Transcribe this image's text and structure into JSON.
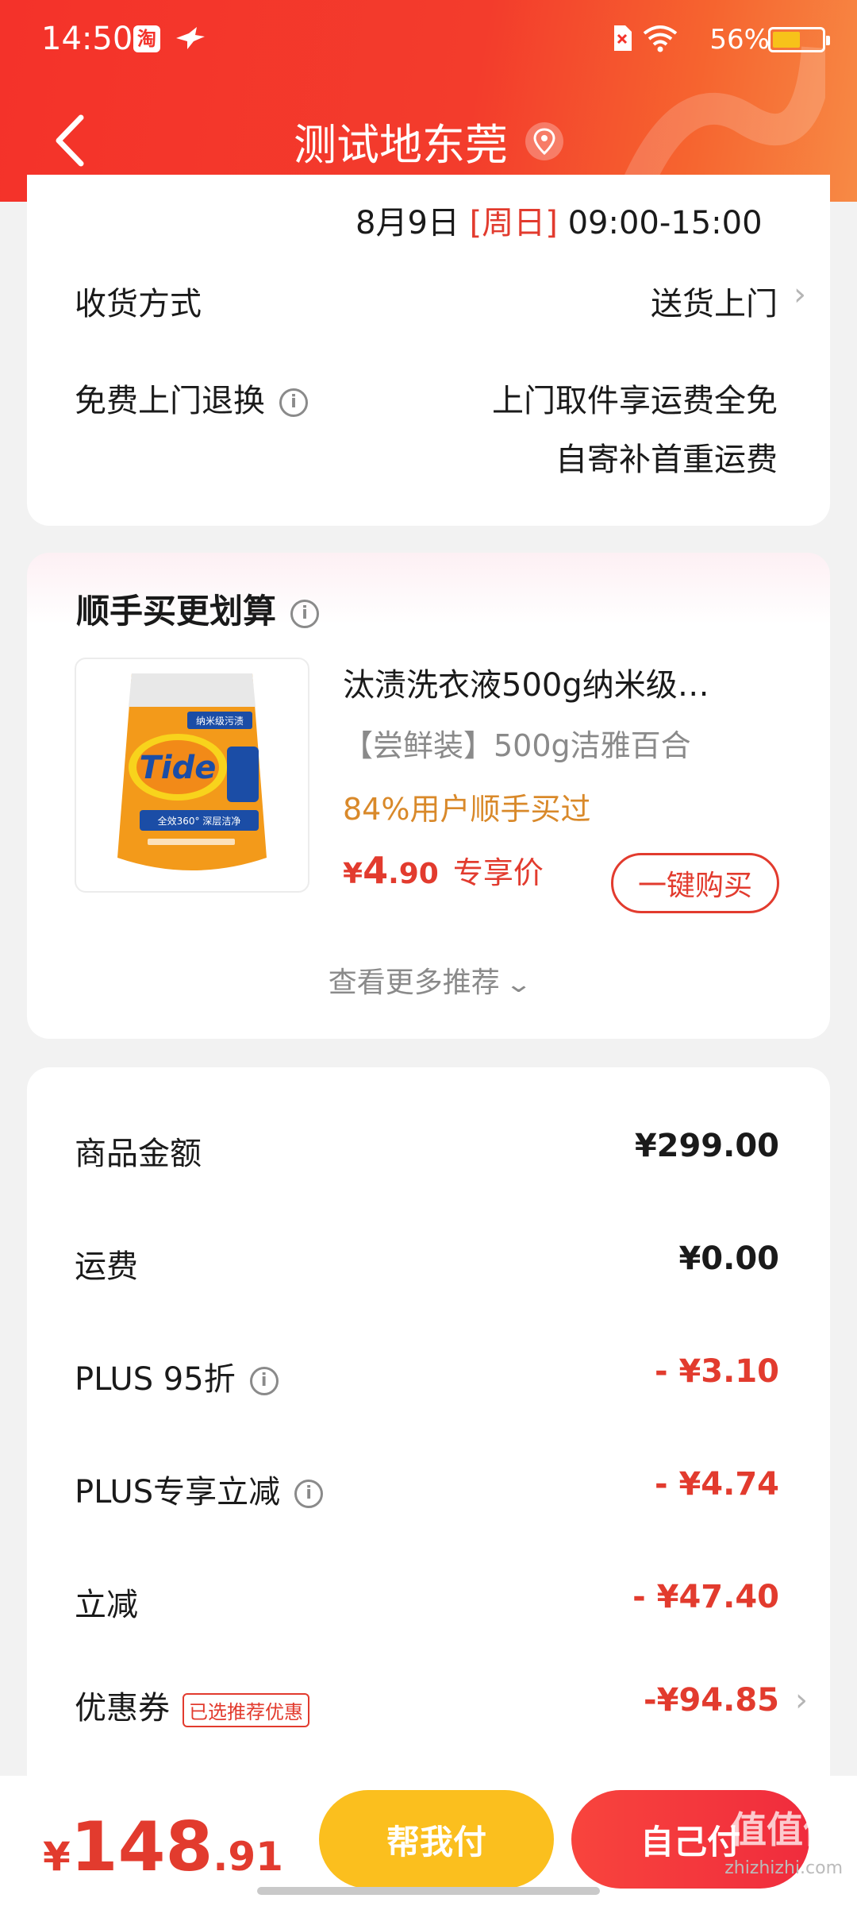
{
  "status_bar": {
    "time": "14:50",
    "battery_pct": "56%",
    "battery_level": 0.56,
    "app1": "淘"
  },
  "header": {
    "title": "测试地东莞"
  },
  "delivery": {
    "peek_date": "8月9日",
    "peek_day": "[周日]",
    "peek_time": "09:00-15:00",
    "method_label": "收货方式",
    "method_value": "送货上门",
    "return_label": "免费上门退换",
    "return_line1": "上门取件享运费全免",
    "return_line2": "自寄补首重运费"
  },
  "recommend": {
    "title": "顺手买更划算",
    "product_name": "汰渍洗衣液500g纳米级…",
    "product_spec": "【尝鲜装】500g洁雅百合",
    "product_sold": "84%用户顺手买过",
    "price_currency": "¥",
    "price_int": "4",
    "price_dec": ".90",
    "price_tag": "专享价",
    "buy_label": "一键购买",
    "more_label": "查看更多推荐",
    "img_brand": "Tide",
    "img_badge": "纳米级污渍",
    "img_sub": "全效360° 深层洁净"
  },
  "amounts": {
    "rows": [
      {
        "label": "商品金额",
        "value": "¥299.00"
      },
      {
        "label": "运费",
        "value": "¥0.00"
      },
      {
        "label": "PLUS 95折",
        "value": "- ¥3.10"
      },
      {
        "label": "PLUS专享立减",
        "value": "- ¥4.74"
      },
      {
        "label": "立减",
        "value": "- ¥47.40"
      },
      {
        "label": "优惠券",
        "value": "-¥94.85"
      }
    ],
    "coupon_tag": "已选推荐优惠"
  },
  "bottom": {
    "currency": "¥",
    "total_int": "148",
    "total_dec": ".91",
    "help_label": "帮我付",
    "self_label": "自己付",
    "watermark": "zhizhizhi.com",
    "watermark_logo": "值值值"
  },
  "colors": {
    "accent": "#e23b2e",
    "header": "#f4322a",
    "help_btn": "#fbbf1e",
    "sold_text": "#d9892a"
  }
}
